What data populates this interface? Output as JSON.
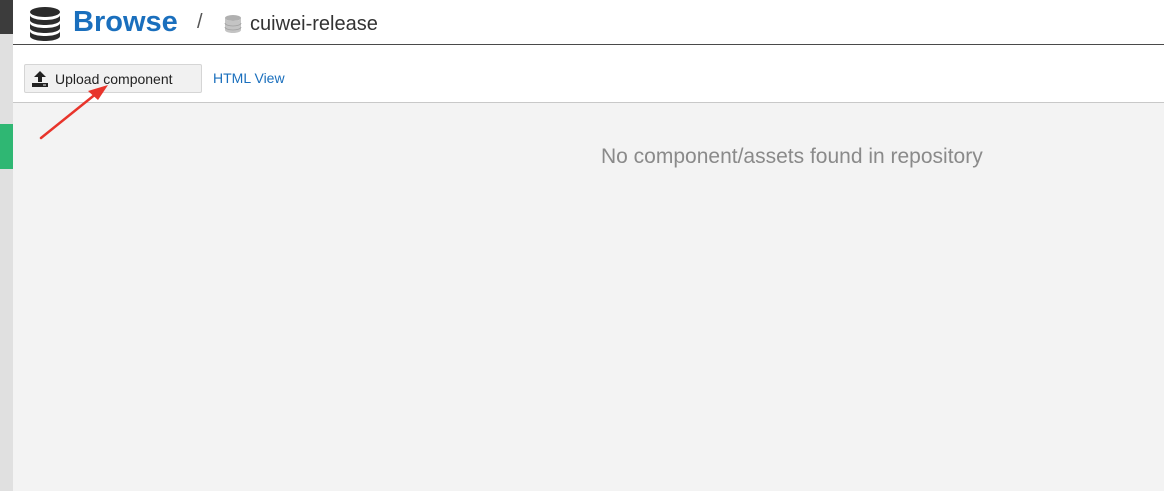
{
  "header": {
    "title": "Browse",
    "separator": "/",
    "repository": "cuiwei-release"
  },
  "toolbar": {
    "upload_label": "Upload component",
    "html_view_label": "HTML View"
  },
  "content": {
    "empty_message": "No component/assets found in repository"
  },
  "colors": {
    "brand_blue": "#1a6fbd",
    "active_green": "#2fb773",
    "annotation_red": "#e8342b"
  },
  "icons": {
    "header": "database-icon",
    "repo": "repository-icon",
    "upload": "upload-icon",
    "annotation": "arrow-annotation"
  }
}
